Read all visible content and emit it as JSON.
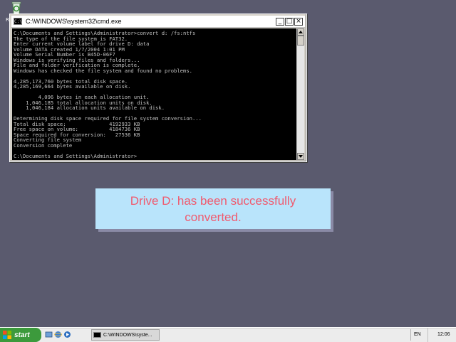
{
  "desktop": {
    "recycle_label": "Re"
  },
  "window": {
    "title": "C:\\WINDOWS\\system32\\cmd.exe",
    "title_icon": "C:\\",
    "minimize_glyph": "_",
    "maximize_glyph": "□",
    "close_glyph": "×",
    "console_lines": [
      "C:\\Documents and Settings\\Administrator>convert d: /fs:ntfs",
      "The type of the file system is FAT32.",
      "Enter current volume label for drive D: data",
      "Volume DATA created 1/7/2004 1:01 PM",
      "Volume Serial Number is B45D-06F7",
      "Windows is verifying files and folders...",
      "File and folder verification is complete.",
      "Windows has checked the file system and found no problems.",
      "",
      "4,285,173,760 bytes total disk space.",
      "4,285,169,664 bytes available on disk.",
      "",
      "        4,096 bytes in each allocation unit.",
      "    1,046,185 total allocation units on disk.",
      "    1,046,184 allocation units available on disk.",
      "",
      "Determining disk space required for file system conversion...",
      "Total disk space:              4192933 KB",
      "Free space on volume:          4184736 KB",
      "Space required for conversion:   27536 KB",
      "Converting file system",
      "Conversion complete",
      "",
      "C:\\Documents and Settings\\Administrator>"
    ]
  },
  "notice": {
    "message": "Drive D: has been successfully converted."
  },
  "taskbar": {
    "start_label": "start",
    "task_label": "C:\\WINDOWS\\syste...",
    "language": "EN",
    "clock": "12:06"
  },
  "icons": {
    "recycle": "recycle-bin-icon",
    "start": "windows-logo-icon",
    "ql1": "show-desktop-icon",
    "ql2": "internet-explorer-icon",
    "ql3": "media-player-icon"
  }
}
